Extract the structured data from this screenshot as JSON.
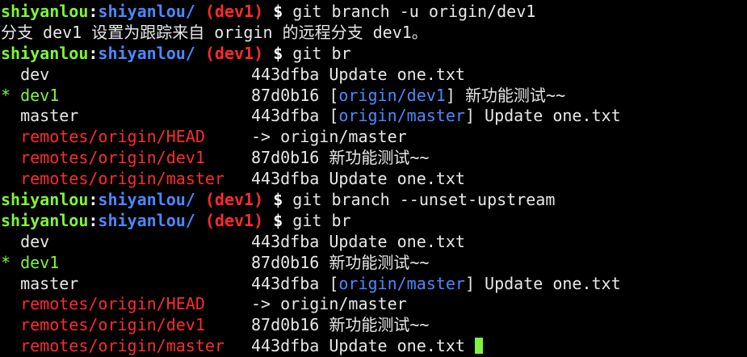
{
  "prompt": {
    "user": "shiyanlou",
    "colon": ":",
    "path": "shiyanlou/",
    "branch": "(dev1)",
    "dollar": "$"
  },
  "lines": [
    {
      "kind": "prompt",
      "command": "git branch -u origin/dev1"
    },
    {
      "kind": "text",
      "text": "分支 dev1 设置为跟踪来自 origin 的远程分支 dev1。"
    },
    {
      "kind": "prompt",
      "command": "git br"
    },
    {
      "kind": "branch",
      "marker": " ",
      "name": "dev",
      "type": "local",
      "sha": "443dfba",
      "upstream": "",
      "msg": "Update one.txt"
    },
    {
      "kind": "branch",
      "marker": "*",
      "name": "dev1",
      "type": "current",
      "sha": "87d0b16",
      "upstream": "origin/dev1",
      "msg": "新功能测试~~"
    },
    {
      "kind": "branch",
      "marker": " ",
      "name": "master",
      "type": "local",
      "sha": "443dfba",
      "upstream": "origin/master",
      "msg": "Update one.txt"
    },
    {
      "kind": "branch",
      "marker": " ",
      "name": "remotes/origin/HEAD",
      "type": "remote",
      "sha": "",
      "upstream": "",
      "msg": "-> origin/master"
    },
    {
      "kind": "branch",
      "marker": " ",
      "name": "remotes/origin/dev1",
      "type": "remote",
      "sha": "87d0b16",
      "upstream": "",
      "msg": "新功能测试~~"
    },
    {
      "kind": "branch",
      "marker": " ",
      "name": "remotes/origin/master",
      "type": "remote",
      "sha": "443dfba",
      "upstream": "",
      "msg": "Update one.txt"
    },
    {
      "kind": "prompt",
      "command": "git branch --unset-upstream"
    },
    {
      "kind": "prompt",
      "command": "git br"
    },
    {
      "kind": "branch",
      "marker": " ",
      "name": "dev",
      "type": "local",
      "sha": "443dfba",
      "upstream": "",
      "msg": "Update one.txt"
    },
    {
      "kind": "branch",
      "marker": "*",
      "name": "dev1",
      "type": "current",
      "sha": "87d0b16",
      "upstream": "",
      "msg": "新功能测试~~"
    },
    {
      "kind": "branch",
      "marker": " ",
      "name": "master",
      "type": "local",
      "sha": "443dfba",
      "upstream": "origin/master",
      "msg": "Update one.txt"
    },
    {
      "kind": "branch",
      "marker": " ",
      "name": "remotes/origin/HEAD",
      "type": "remote",
      "sha": "",
      "upstream": "",
      "msg": "-> origin/master"
    },
    {
      "kind": "branch",
      "marker": " ",
      "name": "remotes/origin/dev1",
      "type": "remote",
      "sha": "87d0b16",
      "upstream": "",
      "msg": "新功能测试~~"
    },
    {
      "kind": "branch",
      "marker": " ",
      "name": "remotes/origin/master",
      "type": "remote",
      "sha": "443dfba",
      "upstream": "",
      "msg": "Update one.txt",
      "cursor": true
    }
  ],
  "colors": {
    "background": "#000000",
    "user": "#7ff53a",
    "path": "#4d88ff",
    "git_branch": "#ff2b2b",
    "current_branch": "#7ff53a",
    "remote_branch": "#ff2b2b",
    "upstream": "#4d88ff",
    "text": "#e8e8e8"
  }
}
